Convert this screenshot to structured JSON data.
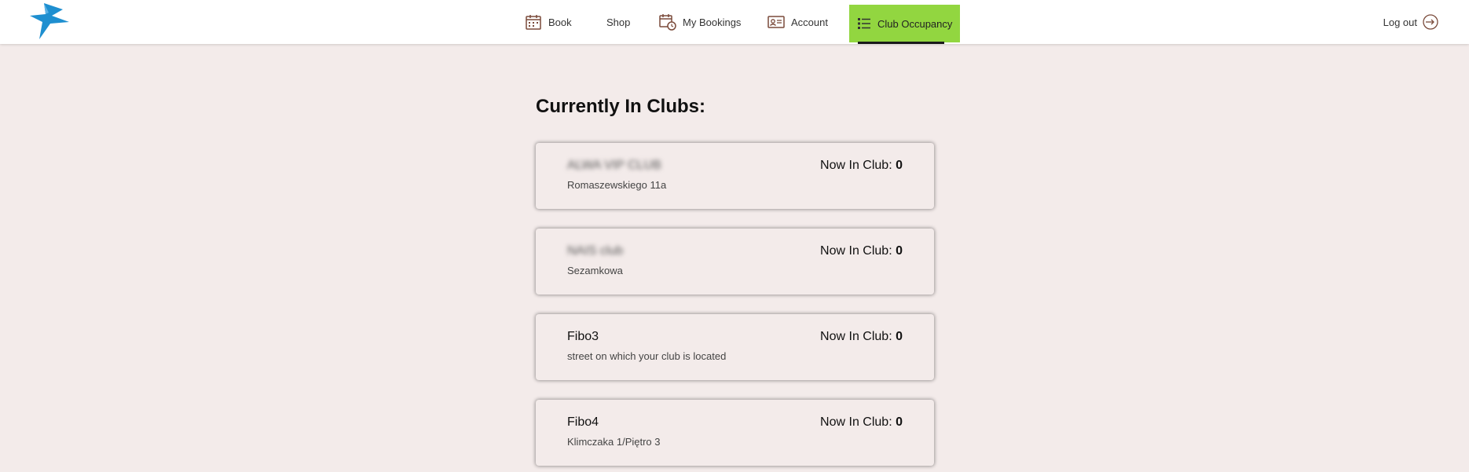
{
  "nav": {
    "items": [
      {
        "label": "Book",
        "icon": "calendar-icon"
      },
      {
        "label": "Shop",
        "icon": ""
      },
      {
        "label": "My Bookings",
        "icon": "calendar-clock-icon"
      },
      {
        "label": "Account",
        "icon": "id-card-icon"
      },
      {
        "label": "Club Occupancy",
        "icon": "list-icon",
        "active": true
      }
    ],
    "logout_label": "Log out",
    "active_color": "#92d640"
  },
  "page": {
    "title": "Currently In Clubs:"
  },
  "clubs": [
    {
      "name": "ALWA VIP CLUB",
      "address": "Romaszewskiego 11a",
      "occupancy_label": "Now In Club:",
      "count": "0",
      "blurred": true
    },
    {
      "name": "NAIS club",
      "address": "Sezamkowa",
      "occupancy_label": "Now In Club:",
      "count": "0",
      "blurred": true
    },
    {
      "name": "Fibo3",
      "address": "street on which your club is located",
      "occupancy_label": "Now In Club:",
      "count": "0",
      "blurred": false
    },
    {
      "name": "Fibo4",
      "address": "Klimczaka 1/Piętro 3",
      "occupancy_label": "Now In Club:",
      "count": "0",
      "blurred": false
    }
  ],
  "colors": {
    "background": "#f3ebea",
    "logo_blue": "#1e8fd0"
  }
}
